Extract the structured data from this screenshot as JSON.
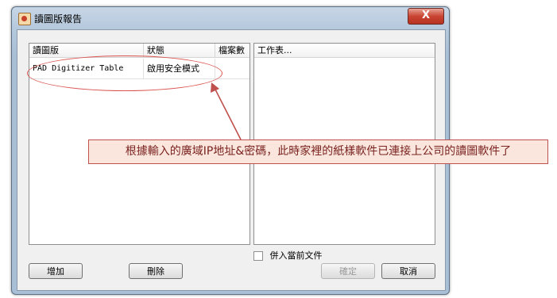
{
  "window": {
    "title": "讀圖版報告",
    "close_label": "X"
  },
  "table": {
    "headers": [
      "讀圖版",
      "狀態",
      "檔案數"
    ],
    "rows": [
      {
        "name": "PAD Digitizer Table",
        "status": "啟用安全模式",
        "count": ""
      }
    ]
  },
  "worksheet": {
    "header": "工作表..."
  },
  "checkbox": {
    "label": "併入當前文件",
    "checked": false
  },
  "buttons": {
    "add": "增加",
    "delete": "刪除",
    "ok": "確定",
    "cancel": "取消"
  },
  "annotation": {
    "text": "根據輸入的廣域IP地址&密碼，此時家裡的紙樣軟件已連接上公司的讀圖軟件了",
    "color": "#c0504d"
  }
}
